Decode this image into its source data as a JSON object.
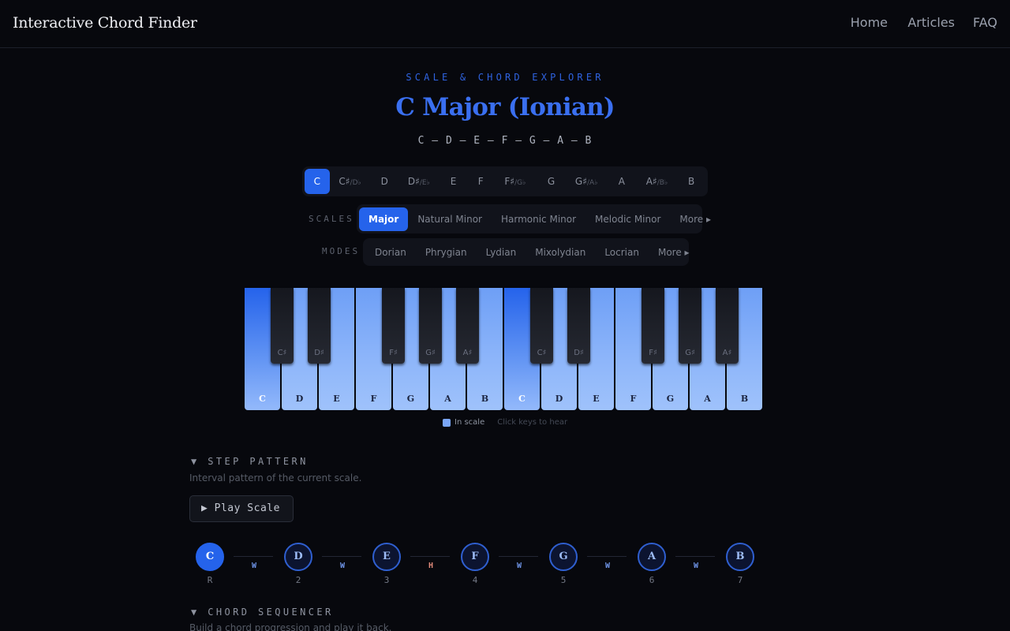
{
  "app": {
    "title": "Interactive Chord Finder",
    "nav": [
      "Home",
      "Articles",
      "FAQ"
    ]
  },
  "header": {
    "eyebrow": "SCALE & CHORD EXPLORER",
    "title": "C Major (Ionian)",
    "notes": "C – D – E – F – G – A – B"
  },
  "roots": [
    {
      "label": "C",
      "alt": "",
      "active": true
    },
    {
      "label": "C♯",
      "alt": "/D♭",
      "active": false
    },
    {
      "label": "D",
      "alt": "",
      "active": false
    },
    {
      "label": "D♯",
      "alt": "/E♭",
      "active": false
    },
    {
      "label": "E",
      "alt": "",
      "active": false
    },
    {
      "label": "F",
      "alt": "",
      "active": false
    },
    {
      "label": "F♯",
      "alt": "/G♭",
      "active": false
    },
    {
      "label": "G",
      "alt": "",
      "active": false
    },
    {
      "label": "G♯",
      "alt": "/A♭",
      "active": false
    },
    {
      "label": "A",
      "alt": "",
      "active": false
    },
    {
      "label": "A♯",
      "alt": "/B♭",
      "active": false
    },
    {
      "label": "B",
      "alt": "",
      "active": false
    }
  ],
  "scales": {
    "label": "SCALES",
    "options": [
      {
        "label": "Major",
        "active": true
      },
      {
        "label": "Natural Minor",
        "active": false
      },
      {
        "label": "Harmonic Minor",
        "active": false
      },
      {
        "label": "Melodic Minor",
        "active": false
      },
      {
        "label": "More ▸",
        "active": false
      }
    ]
  },
  "modes": {
    "label": "MODES",
    "options": [
      {
        "label": "Dorian",
        "active": false
      },
      {
        "label": "Phrygian",
        "active": false
      },
      {
        "label": "Lydian",
        "active": false
      },
      {
        "label": "Mixolydian",
        "active": false
      },
      {
        "label": "Locrian",
        "active": false
      },
      {
        "label": "More ▸",
        "active": false
      }
    ]
  },
  "keyboard": {
    "white_keys": [
      {
        "label": "C",
        "root": true
      },
      {
        "label": "D",
        "root": false
      },
      {
        "label": "E",
        "root": false
      },
      {
        "label": "F",
        "root": false
      },
      {
        "label": "G",
        "root": false
      },
      {
        "label": "A",
        "root": false
      },
      {
        "label": "B",
        "root": false
      },
      {
        "label": "C",
        "root": true
      },
      {
        "label": "D",
        "root": false
      },
      {
        "label": "E",
        "root": false
      },
      {
        "label": "F",
        "root": false
      },
      {
        "label": "G",
        "root": false
      },
      {
        "label": "A",
        "root": false
      },
      {
        "label": "B",
        "root": false
      }
    ],
    "black_keys": [
      "C♯",
      "D♯",
      "F♯",
      "G♯",
      "A♯",
      "C♯",
      "D♯",
      "F♯",
      "G♯",
      "A♯"
    ],
    "legend_in_scale": "In scale",
    "legend_hint": "Click keys to hear",
    "colors": {
      "in_scale": "#8eb6fa",
      "root": "#2563eb"
    }
  },
  "step_pattern": {
    "heading": "▼ STEP PATTERN",
    "description": "Interval pattern of the current scale.",
    "play_label": "▶ Play Scale",
    "degrees": [
      {
        "note": "C",
        "degree": "R",
        "root": true
      },
      {
        "note": "D",
        "degree": "2",
        "root": false
      },
      {
        "note": "E",
        "degree": "3",
        "root": false
      },
      {
        "note": "F",
        "degree": "4",
        "root": false
      },
      {
        "note": "G",
        "degree": "5",
        "root": false
      },
      {
        "note": "A",
        "degree": "6",
        "root": false
      },
      {
        "note": "B",
        "degree": "7",
        "root": false
      }
    ],
    "steps": [
      "W",
      "W",
      "H",
      "W",
      "W",
      "W"
    ]
  },
  "chord_sequencer": {
    "heading": "▼ CHORD SEQUENCER",
    "description": "Build a chord progression and play it back."
  }
}
